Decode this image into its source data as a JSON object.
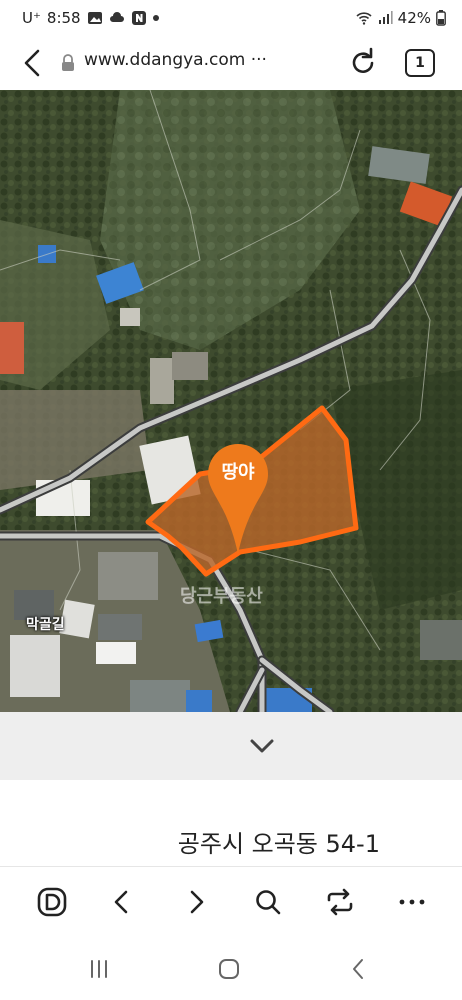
{
  "status_bar": {
    "carrier": "U⁺",
    "time": "8:58",
    "battery": "42%",
    "icons": [
      "gallery-icon",
      "cloud-icon",
      "naver-icon",
      "notification-dot",
      "wifi-icon",
      "signal-icon",
      "battery-icon"
    ]
  },
  "browser": {
    "url": "www.ddangya.com ···",
    "tab_count": "1"
  },
  "map": {
    "road_label": "막골길",
    "pin_label": "땅야",
    "watermark": "당근부동산",
    "highlight_color": "#ff6a13",
    "pin_color": "#ee7a1c"
  },
  "property": {
    "address": "공주시 오곡동 54-1"
  },
  "toolbar": {
    "buttons": [
      "home-icon",
      "back-icon",
      "forward-icon",
      "search-icon",
      "share-icon",
      "more-icon"
    ]
  },
  "system_nav": {
    "buttons": [
      "recents-icon",
      "home-icon",
      "back-icon"
    ]
  }
}
